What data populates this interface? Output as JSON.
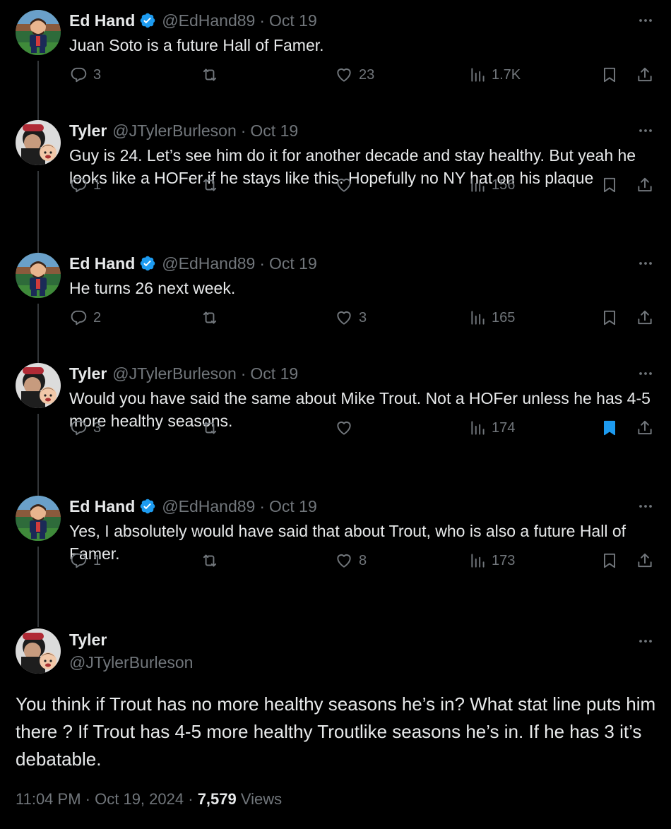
{
  "colors": {
    "background": "#000000",
    "text": "#e7e9ea",
    "muted": "#71767b",
    "verified": "#1d9bf0",
    "bookmark_active": "#1d9bf0"
  },
  "replies": [
    {
      "name": "Ed Hand",
      "verified": true,
      "handle": "@EdHand89",
      "sep": "·",
      "date": "Oct 19",
      "text": "Juan Soto is a future Hall of Famer.",
      "reply_count": "3",
      "like_count": "23",
      "views": "1.7K",
      "bookmarked": false
    },
    {
      "name": "Tyler",
      "verified": false,
      "handle": "@JTylerBurleson",
      "sep": "·",
      "date": "Oct 19",
      "text": "Guy is 24. Let’s see him do it for another decade and stay healthy. But yeah he looks like a HOFer if he stays like this. Hopefully no NY hat on his plaque",
      "reply_count": "1",
      "like_count": "",
      "views": "156",
      "bookmarked": false
    },
    {
      "name": "Ed Hand",
      "verified": true,
      "handle": "@EdHand89",
      "sep": "·",
      "date": "Oct 19",
      "text": "He turns 26 next week.",
      "reply_count": "2",
      "like_count": "3",
      "views": "165",
      "bookmarked": false
    },
    {
      "name": "Tyler",
      "verified": false,
      "handle": "@JTylerBurleson",
      "sep": "·",
      "date": "Oct 19",
      "text": "Would you have said the same about Mike Trout. Not a HOFer unless he has 4-5 more healthy seasons.",
      "reply_count": "3",
      "like_count": "",
      "views": "174",
      "bookmarked": true
    },
    {
      "name": "Ed Hand",
      "verified": true,
      "handle": "@EdHand89",
      "sep": "·",
      "date": "Oct 19",
      "text": "Yes, I absolutely would have said that about Trout, who is also a future Hall of Famer.",
      "reply_count": "1",
      "like_count": "8",
      "views": "173",
      "bookmarked": false
    }
  ],
  "main_tweet": {
    "name": "Tyler",
    "handle": "@JTylerBurleson",
    "text": "You think if Trout has no more healthy seasons he’s in? What stat line puts him there ?  If Trout has 4-5 more healthy Troutlike seasons he’s in. If he has 3 it’s debatable.",
    "time": "11:04 PM",
    "sep": "·",
    "date": "Oct 19, 2024",
    "views_count": "7,579",
    "views_label": "Views"
  },
  "icons": [
    "avatar-ed-hand",
    "avatar-tyler",
    "verified-badge-icon",
    "more-icon",
    "reply-icon",
    "retweet-icon",
    "like-icon",
    "views-icon",
    "bookmark-icon",
    "share-icon"
  ]
}
